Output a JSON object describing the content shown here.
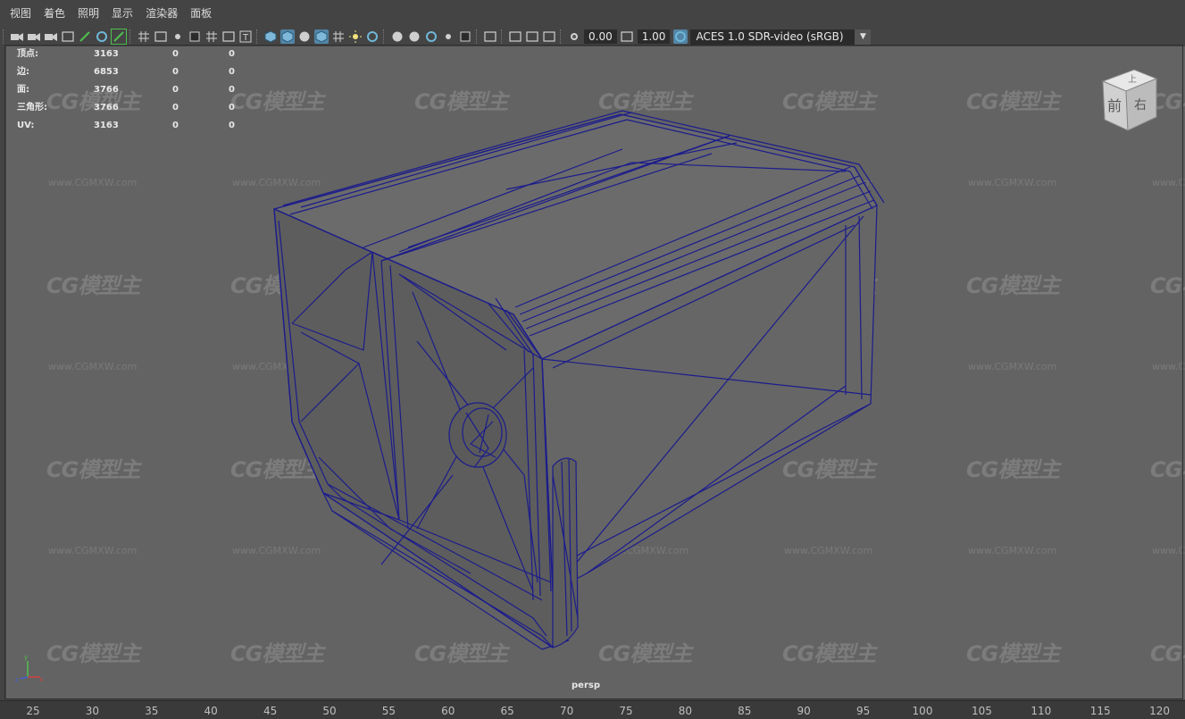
{
  "menu": [
    "视图",
    "着色",
    "照明",
    "显示",
    "渲染器",
    "面板"
  ],
  "toolbar": {
    "exposure_value": "0.00",
    "gamma_value": "1.00",
    "color_space": "ACES 1.0 SDR-video (sRGB)",
    "icons": [
      "camera-select-icon",
      "camera-attributes-icon",
      "bookmark-icon",
      "image-plane-icon",
      "grid-toggle-icon",
      "film-gate-icon",
      "resolution-gate-icon",
      "gate-mask-icon",
      "field-chart-icon",
      "safe-action-icon",
      "safe-title-icon",
      "wireframe-icon",
      "smooth-shade-icon",
      "default-material-icon",
      "textured-icon",
      "use-lights-icon",
      "shadows-icon",
      "ambient-occlusion-icon",
      "motion-blur-icon",
      "anti-aliasing-icon",
      "depth-of-field-icon",
      "isolate-select-icon",
      "xray-icon",
      "xray-active-icon",
      "xray-joints-icon",
      "backface-culling-icon",
      "exposure-icon",
      "gamma-icon",
      "color-management-icon"
    ]
  },
  "hud": {
    "rows": [
      {
        "label": "顶点:",
        "v1": "3163",
        "v2": "0",
        "v3": "0"
      },
      {
        "label": "边:",
        "v1": "6853",
        "v2": "0",
        "v3": "0"
      },
      {
        "label": "面:",
        "v1": "3766",
        "v2": "0",
        "v3": "0"
      },
      {
        "label": "三角形:",
        "v1": "3766",
        "v2": "0",
        "v3": "0"
      },
      {
        "label": "UV:",
        "v1": "3163",
        "v2": "0",
        "v3": "0"
      }
    ]
  },
  "viewcube": {
    "top": "上",
    "front": "前",
    "right": "右"
  },
  "camera_label": "persp",
  "watermark": {
    "logo": "CG模型主",
    "url": "www.CGMXW.com"
  },
  "ruler": [
    "25",
    "30",
    "35",
    "40",
    "45",
    "50",
    "55",
    "60",
    "65",
    "70",
    "75",
    "80",
    "85",
    "90",
    "95",
    "100",
    "105",
    "110",
    "115",
    "120"
  ],
  "colors": {
    "wire": "#1c1c8c",
    "viewport_bg": "#636363",
    "accent": "#5285a6"
  }
}
